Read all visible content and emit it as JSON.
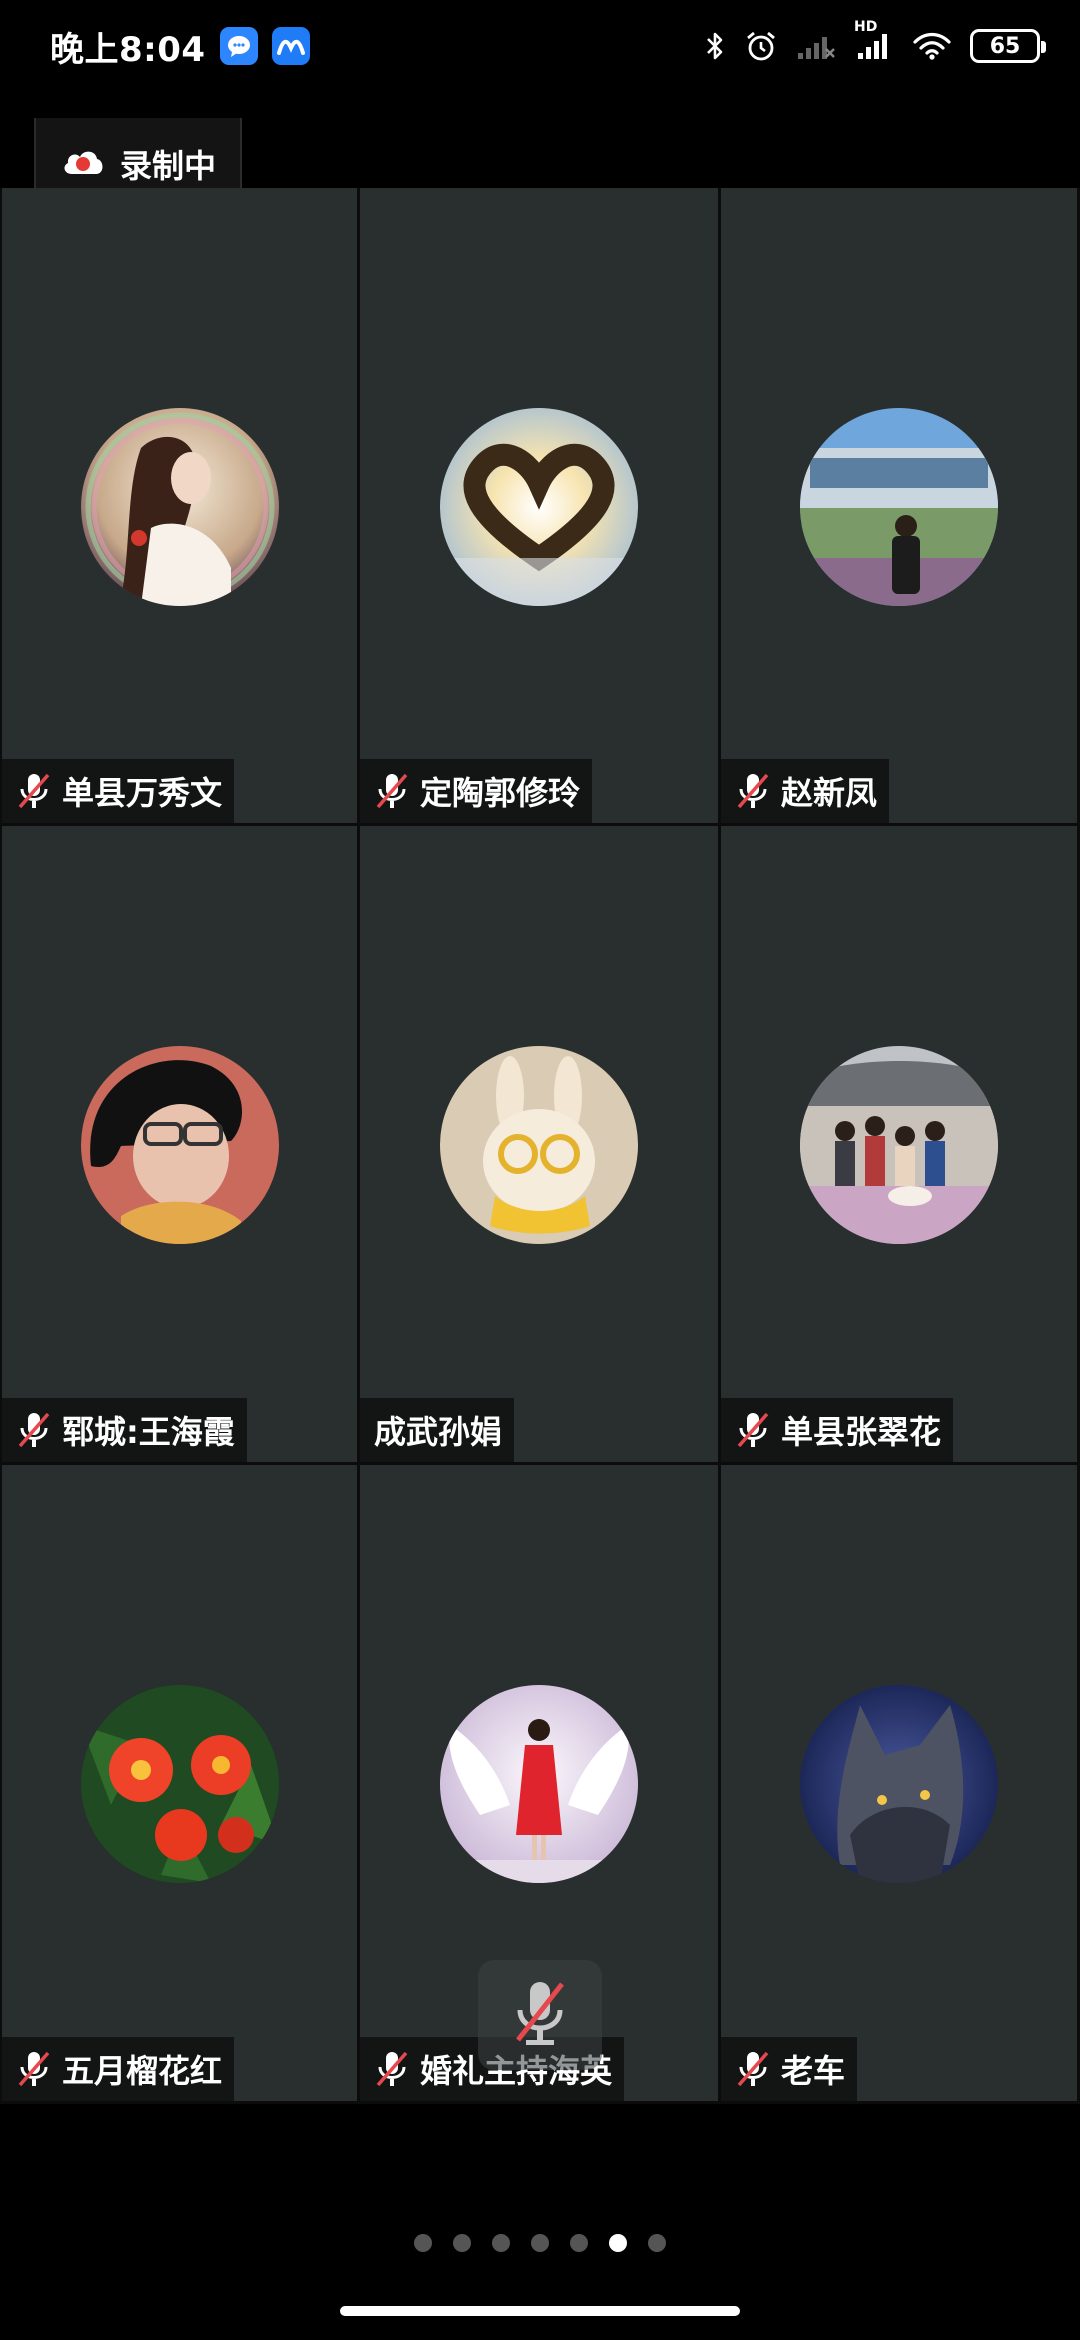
{
  "status_bar": {
    "time": "晚上8:04",
    "battery": "65",
    "network_label": "HD"
  },
  "recording": {
    "label": "录制中"
  },
  "participants": [
    {
      "name": "单县万秀文",
      "muted": true,
      "avatar": "woman-portrait"
    },
    {
      "name": "定陶郭修玲",
      "muted": true,
      "avatar": "heart-hands-sunset"
    },
    {
      "name": "赵新凤",
      "muted": true,
      "avatar": "man-in-front-of-building"
    },
    {
      "name": "郓城:王海霞",
      "muted": true,
      "avatar": "woman-with-glasses"
    },
    {
      "name": "成武孙娟",
      "muted": false,
      "avatar": "cartoon-rabbit"
    },
    {
      "name": "单县张翠花",
      "muted": true,
      "avatar": "family-group-photo"
    },
    {
      "name": "五月榴花红",
      "muted": true,
      "avatar": "red-flowers"
    },
    {
      "name": "婚礼主持海英",
      "muted": true,
      "avatar": "woman-in-red-dress"
    },
    {
      "name": "老车",
      "muted": true,
      "avatar": "wolf"
    }
  ],
  "pagination": {
    "total_pages": 7,
    "current_page": 6
  },
  "colors": {
    "tile_bg": "#292e2e",
    "mute_slash": "#e5484d",
    "recording_dot": "#e53935"
  }
}
